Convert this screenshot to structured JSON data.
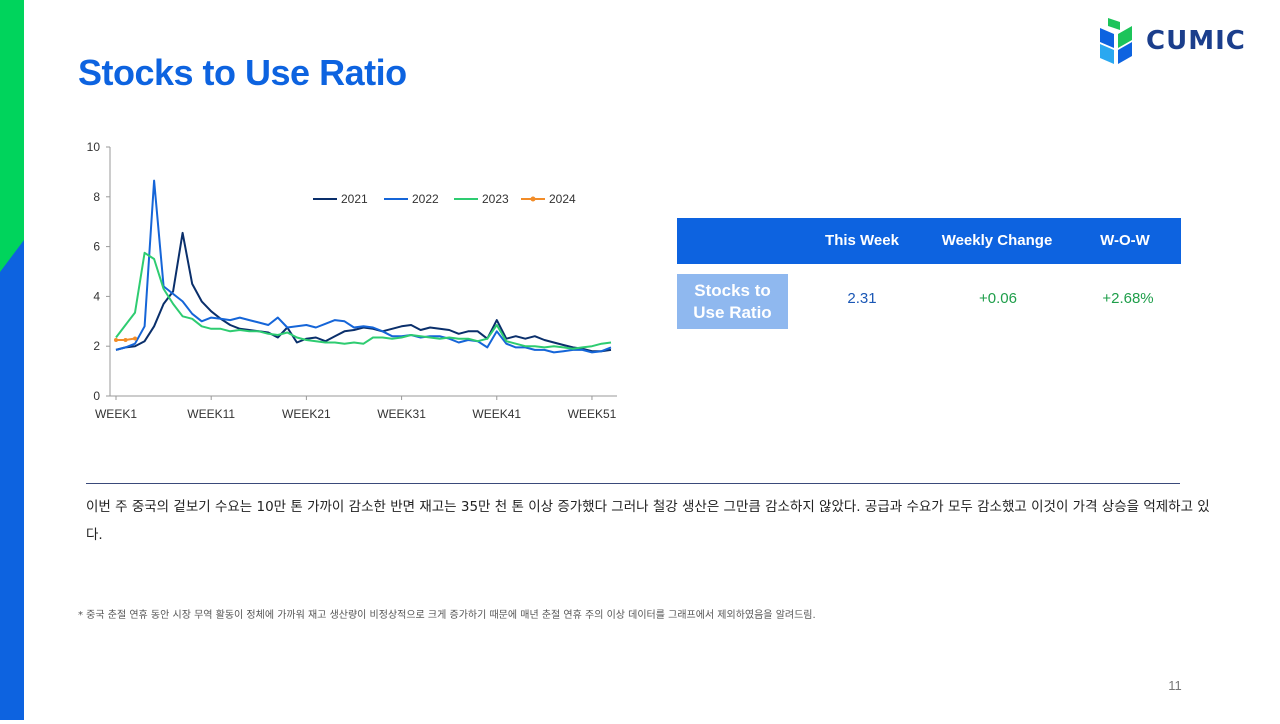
{
  "slide": {
    "title": "Stocks to Use Ratio",
    "logo_text": "CUMIC",
    "page_number": "11",
    "body_text": "이번 주 중국의 겉보기 수요는 10만 톤 가까이 감소한 반면 재고는 35만 천 톤 이상 증가했다 그러나 철강 생산은 그만큼 감소하지 않았다. 공급과 수요가 모두 감소했고 이것이 가격 상승을 억제하고 있다.",
    "footnote": "* 중국 춘절 연휴 동안 시장 무역 활동이 정체에 가까워 재고 생산량이 비정상적으로 크게 증가하기 때문에 매년 춘절 연휴 주의 이상 데이터를 그래프에서 제외하였음을 알려드림.",
    "colors": {
      "accent_blue": "#0d63e0",
      "green": "#00c853",
      "label_bg": "#8fb8ef"
    }
  },
  "table": {
    "headers": [
      "",
      "This Week",
      "Weekly Change",
      "W-O-W"
    ],
    "row_label": "Stocks to Use Ratio",
    "values": [
      "2.31",
      "+0.06",
      "+2.68%"
    ]
  },
  "chart_data": {
    "type": "line",
    "ylim": [
      0,
      10
    ],
    "yticks": [
      "0",
      "2",
      "4",
      "6",
      "8",
      "10"
    ],
    "xlim": [
      1,
      53
    ],
    "xticks": [
      {
        "x": 1,
        "label": "WEEK1"
      },
      {
        "x": 11,
        "label": "WEEK11"
      },
      {
        "x": 21,
        "label": "WEEK21"
      },
      {
        "x": 31,
        "label": "WEEK31"
      },
      {
        "x": 41,
        "label": "WEEK41"
      },
      {
        "x": 51,
        "label": "WEEK51"
      }
    ],
    "legend_position": "top-right",
    "series": [
      {
        "name": "2021",
        "color": "#0a2f6b",
        "marker": false,
        "values": [
          1.85,
          1.95,
          2.0,
          2.2,
          2.8,
          3.7,
          4.2,
          6.55,
          4.5,
          3.8,
          3.4,
          3.1,
          2.85,
          2.7,
          2.65,
          2.6,
          2.55,
          2.35,
          2.75,
          2.15,
          2.3,
          2.35,
          2.2,
          2.4,
          2.6,
          2.65,
          2.75,
          2.7,
          2.6,
          2.7,
          2.8,
          2.85,
          2.65,
          2.75,
          2.7,
          2.65,
          2.5,
          2.6,
          2.6,
          2.3,
          3.05,
          2.3,
          2.4,
          2.3,
          2.4,
          2.25,
          2.15,
          2.05,
          1.95,
          1.9,
          1.8,
          1.8,
          1.85
        ]
      },
      {
        "name": "2022",
        "color": "#1565d8",
        "marker": false,
        "values": [
          1.85,
          1.95,
          2.1,
          2.8,
          8.65,
          4.4,
          4.1,
          3.8,
          3.3,
          3.0,
          3.15,
          3.1,
          3.05,
          3.15,
          3.05,
          2.95,
          2.85,
          3.15,
          2.75,
          2.8,
          2.85,
          2.75,
          2.9,
          3.05,
          3.0,
          2.75,
          2.8,
          2.75,
          2.6,
          2.4,
          2.4,
          2.45,
          2.35,
          2.4,
          2.4,
          2.3,
          2.15,
          2.25,
          2.2,
          1.95,
          2.6,
          2.1,
          1.95,
          1.95,
          1.85,
          1.85,
          1.75,
          1.8,
          1.85,
          1.85,
          1.75,
          1.8,
          1.95
        ]
      },
      {
        "name": "2023",
        "color": "#2ecc71",
        "marker": false,
        "values": [
          2.35,
          2.85,
          3.35,
          5.75,
          5.5,
          4.3,
          3.7,
          3.2,
          3.1,
          2.8,
          2.7,
          2.7,
          2.6,
          2.65,
          2.6,
          2.6,
          2.5,
          2.45,
          2.55,
          2.35,
          2.25,
          2.2,
          2.15,
          2.15,
          2.1,
          2.15,
          2.1,
          2.35,
          2.35,
          2.3,
          2.35,
          2.45,
          2.4,
          2.35,
          2.3,
          2.35,
          2.3,
          2.3,
          2.2,
          2.3,
          2.85,
          2.2,
          2.1,
          2.0,
          2.0,
          1.95,
          2.0,
          1.95,
          1.9,
          1.95,
          2.0,
          2.1,
          2.15
        ]
      },
      {
        "name": "2024",
        "color": "#f28c28",
        "marker": true,
        "values": [
          2.25,
          2.25,
          2.31
        ]
      }
    ]
  }
}
